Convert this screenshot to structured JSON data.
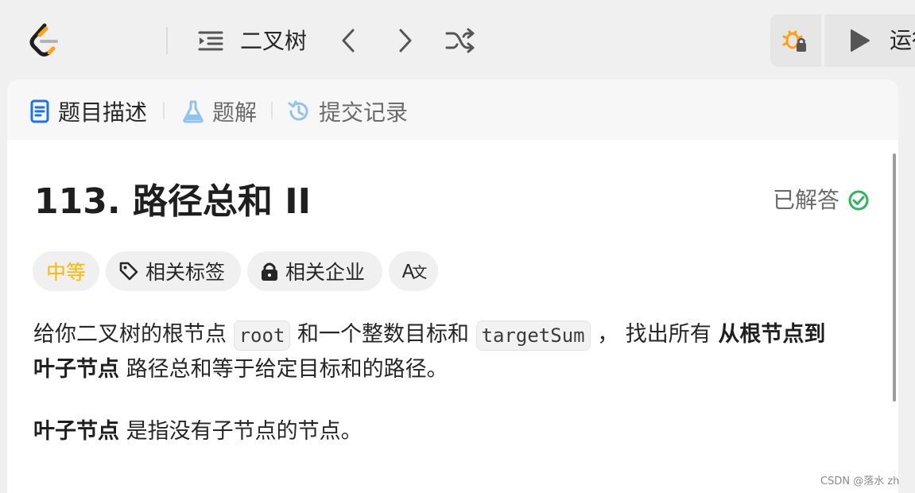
{
  "header": {
    "problem_name": "二叉树",
    "run_label": "运行"
  },
  "tabs": [
    {
      "label": "题目描述"
    },
    {
      "label": "题解"
    },
    {
      "label": "提交记录"
    }
  ],
  "problem": {
    "title": "113. 路径总和 II",
    "status": "已解答",
    "chips": {
      "difficulty": "中等",
      "tags": "相关标签",
      "companies": "相关企业",
      "translate": "A文"
    },
    "desc": {
      "p1_a": "给你二叉树的根节点 ",
      "code1": "root",
      "p1_b": " 和一个整数目标和 ",
      "code2": "targetSum",
      "p1_c": " ， 找出所有 ",
      "p1_bold1": "从根节点到",
      "p1_bold2": "叶子节点",
      "p1_d": " 路径总和等于给定目标和的路径。",
      "p2_bold": "叶子节点",
      "p2_rest": " 是指没有子节点的节点。"
    }
  },
  "watermark": "CSDN @落水 zh",
  "colors": {
    "difficulty": "#ffb800",
    "solved_check": "#2db55d",
    "tab_icon_desc": "#1a73e8",
    "tab_icon_sol": "#8fc3f0",
    "logo_orange": "#ffa116"
  }
}
